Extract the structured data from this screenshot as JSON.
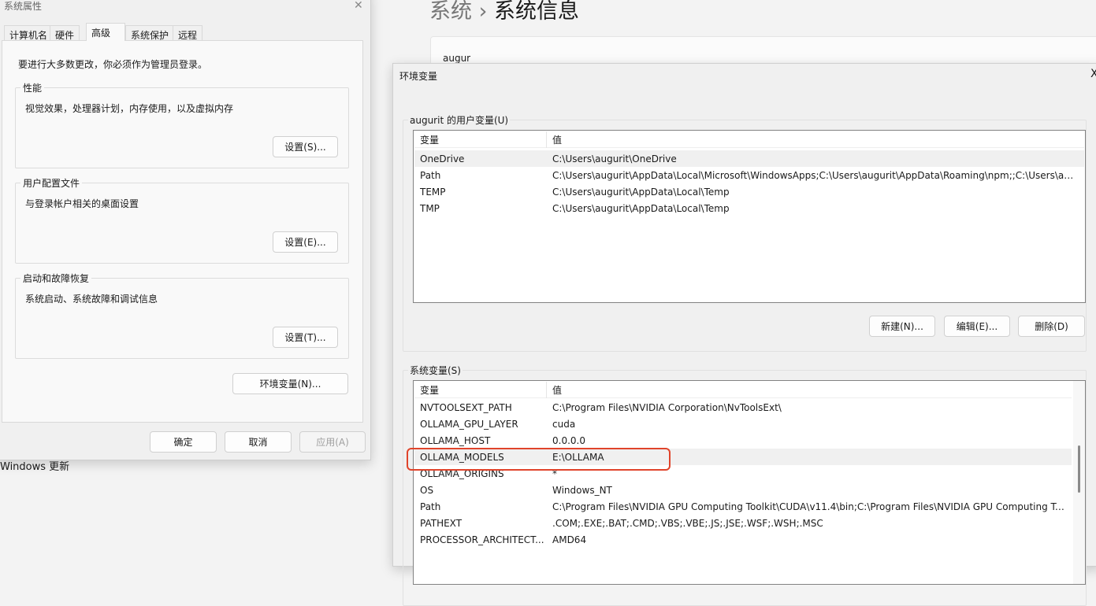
{
  "background": {
    "breadcrumb_parent": "系统",
    "breadcrumb_sep": "›",
    "breadcrumb_current": "系统信息",
    "card_text": "augur",
    "windows_update": "Windows 更新"
  },
  "sys_props": {
    "title": "系统属性",
    "tabs": [
      "计算机名",
      "硬件",
      "高级",
      "系统保护",
      "远程"
    ],
    "active_tab": 2,
    "admin_note": "要进行大多数更改，你必须作为管理员登录。",
    "groups": [
      {
        "label": "性能",
        "desc": "视觉效果，处理器计划，内存使用，以及虚拟内存",
        "button": "设置(S)..."
      },
      {
        "label": "用户配置文件",
        "desc": "与登录帐户相关的桌面设置",
        "button": "设置(E)..."
      },
      {
        "label": "启动和故障恢复",
        "desc": "系统启动、系统故障和调试信息",
        "button": "设置(T)..."
      }
    ],
    "env_button": "环境变量(N)...",
    "ok": "确定",
    "cancel": "取消",
    "apply": "应用(A)"
  },
  "env_dialog": {
    "title": "环境变量",
    "close": "X",
    "user_group": "augurit 的用户变量(U)",
    "col_var": "变量",
    "col_val": "值",
    "user_vars": [
      {
        "name": "OneDrive",
        "value": "C:\\Users\\augurit\\OneDrive"
      },
      {
        "name": "Path",
        "value": "C:\\Users\\augurit\\AppData\\Local\\Microsoft\\WindowsApps;C:\\Users\\augurit\\AppData\\Roaming\\npm;;C:\\Users\\aug..."
      },
      {
        "name": "TEMP",
        "value": "C:\\Users\\augurit\\AppData\\Local\\Temp"
      },
      {
        "name": "TMP",
        "value": "C:\\Users\\augurit\\AppData\\Local\\Temp"
      }
    ],
    "new": "新建(N)...",
    "edit": "编辑(E)...",
    "delete": "删除(D)",
    "sys_group": "系统变量(S)",
    "sys_vars": [
      {
        "name": "NVTOOLSEXT_PATH",
        "value": "C:\\Program Files\\NVIDIA Corporation\\NvToolsExt\\"
      },
      {
        "name": "OLLAMA_GPU_LAYER",
        "value": "cuda"
      },
      {
        "name": "OLLAMA_HOST",
        "value": "0.0.0.0"
      },
      {
        "name": "OLLAMA_MODELS",
        "value": "E:\\OLLAMA"
      },
      {
        "name": "OLLAMA_ORIGINS",
        "value": "*"
      },
      {
        "name": "OS",
        "value": "Windows_NT"
      },
      {
        "name": "Path",
        "value": "C:\\Program Files\\NVIDIA GPU Computing Toolkit\\CUDA\\v11.4\\bin;C:\\Program Files\\NVIDIA GPU Computing To..."
      },
      {
        "name": "PATHEXT",
        "value": ".COM;.EXE;.BAT;.CMD;.VBS;.VBE;.JS;.JSE;.WSF;.WSH;.MSC"
      },
      {
        "name": "PROCESSOR_ARCHITECT...",
        "value": "AMD64"
      }
    ],
    "selected_sys_index": 3,
    "highlight_color": "#e0442b"
  }
}
